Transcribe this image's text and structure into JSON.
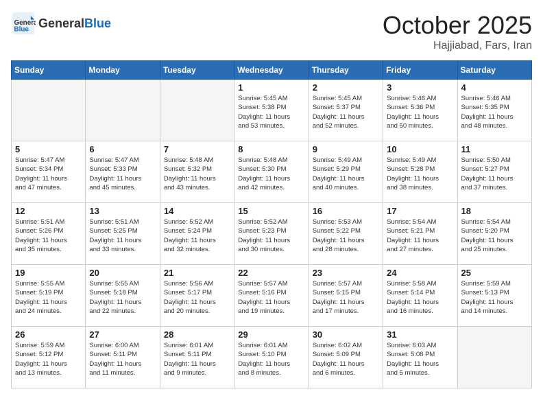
{
  "header": {
    "logo_general": "General",
    "logo_blue": "Blue",
    "month": "October 2025",
    "location": "Hajjiabad, Fars, Iran"
  },
  "weekdays": [
    "Sunday",
    "Monday",
    "Tuesday",
    "Wednesday",
    "Thursday",
    "Friday",
    "Saturday"
  ],
  "weeks": [
    [
      {
        "day": "",
        "info": "",
        "empty": true
      },
      {
        "day": "",
        "info": "",
        "empty": true
      },
      {
        "day": "",
        "info": "",
        "empty": true
      },
      {
        "day": "1",
        "info": "Sunrise: 5:45 AM\nSunset: 5:38 PM\nDaylight: 11 hours\nand 53 minutes."
      },
      {
        "day": "2",
        "info": "Sunrise: 5:45 AM\nSunset: 5:37 PM\nDaylight: 11 hours\nand 52 minutes."
      },
      {
        "day": "3",
        "info": "Sunrise: 5:46 AM\nSunset: 5:36 PM\nDaylight: 11 hours\nand 50 minutes."
      },
      {
        "day": "4",
        "info": "Sunrise: 5:46 AM\nSunset: 5:35 PM\nDaylight: 11 hours\nand 48 minutes."
      }
    ],
    [
      {
        "day": "5",
        "info": "Sunrise: 5:47 AM\nSunset: 5:34 PM\nDaylight: 11 hours\nand 47 minutes."
      },
      {
        "day": "6",
        "info": "Sunrise: 5:47 AM\nSunset: 5:33 PM\nDaylight: 11 hours\nand 45 minutes."
      },
      {
        "day": "7",
        "info": "Sunrise: 5:48 AM\nSunset: 5:32 PM\nDaylight: 11 hours\nand 43 minutes."
      },
      {
        "day": "8",
        "info": "Sunrise: 5:48 AM\nSunset: 5:30 PM\nDaylight: 11 hours\nand 42 minutes."
      },
      {
        "day": "9",
        "info": "Sunrise: 5:49 AM\nSunset: 5:29 PM\nDaylight: 11 hours\nand 40 minutes."
      },
      {
        "day": "10",
        "info": "Sunrise: 5:49 AM\nSunset: 5:28 PM\nDaylight: 11 hours\nand 38 minutes."
      },
      {
        "day": "11",
        "info": "Sunrise: 5:50 AM\nSunset: 5:27 PM\nDaylight: 11 hours\nand 37 minutes."
      }
    ],
    [
      {
        "day": "12",
        "info": "Sunrise: 5:51 AM\nSunset: 5:26 PM\nDaylight: 11 hours\nand 35 minutes."
      },
      {
        "day": "13",
        "info": "Sunrise: 5:51 AM\nSunset: 5:25 PM\nDaylight: 11 hours\nand 33 minutes."
      },
      {
        "day": "14",
        "info": "Sunrise: 5:52 AM\nSunset: 5:24 PM\nDaylight: 11 hours\nand 32 minutes."
      },
      {
        "day": "15",
        "info": "Sunrise: 5:52 AM\nSunset: 5:23 PM\nDaylight: 11 hours\nand 30 minutes."
      },
      {
        "day": "16",
        "info": "Sunrise: 5:53 AM\nSunset: 5:22 PM\nDaylight: 11 hours\nand 28 minutes."
      },
      {
        "day": "17",
        "info": "Sunrise: 5:54 AM\nSunset: 5:21 PM\nDaylight: 11 hours\nand 27 minutes."
      },
      {
        "day": "18",
        "info": "Sunrise: 5:54 AM\nSunset: 5:20 PM\nDaylight: 11 hours\nand 25 minutes."
      }
    ],
    [
      {
        "day": "19",
        "info": "Sunrise: 5:55 AM\nSunset: 5:19 PM\nDaylight: 11 hours\nand 24 minutes."
      },
      {
        "day": "20",
        "info": "Sunrise: 5:55 AM\nSunset: 5:18 PM\nDaylight: 11 hours\nand 22 minutes."
      },
      {
        "day": "21",
        "info": "Sunrise: 5:56 AM\nSunset: 5:17 PM\nDaylight: 11 hours\nand 20 minutes."
      },
      {
        "day": "22",
        "info": "Sunrise: 5:57 AM\nSunset: 5:16 PM\nDaylight: 11 hours\nand 19 minutes."
      },
      {
        "day": "23",
        "info": "Sunrise: 5:57 AM\nSunset: 5:15 PM\nDaylight: 11 hours\nand 17 minutes."
      },
      {
        "day": "24",
        "info": "Sunrise: 5:58 AM\nSunset: 5:14 PM\nDaylight: 11 hours\nand 16 minutes."
      },
      {
        "day": "25",
        "info": "Sunrise: 5:59 AM\nSunset: 5:13 PM\nDaylight: 11 hours\nand 14 minutes."
      }
    ],
    [
      {
        "day": "26",
        "info": "Sunrise: 5:59 AM\nSunset: 5:12 PM\nDaylight: 11 hours\nand 13 minutes."
      },
      {
        "day": "27",
        "info": "Sunrise: 6:00 AM\nSunset: 5:11 PM\nDaylight: 11 hours\nand 11 minutes."
      },
      {
        "day": "28",
        "info": "Sunrise: 6:01 AM\nSunset: 5:11 PM\nDaylight: 11 hours\nand 9 minutes."
      },
      {
        "day": "29",
        "info": "Sunrise: 6:01 AM\nSunset: 5:10 PM\nDaylight: 11 hours\nand 8 minutes."
      },
      {
        "day": "30",
        "info": "Sunrise: 6:02 AM\nSunset: 5:09 PM\nDaylight: 11 hours\nand 6 minutes."
      },
      {
        "day": "31",
        "info": "Sunrise: 6:03 AM\nSunset: 5:08 PM\nDaylight: 11 hours\nand 5 minutes."
      },
      {
        "day": "",
        "info": "",
        "empty": true
      }
    ]
  ]
}
